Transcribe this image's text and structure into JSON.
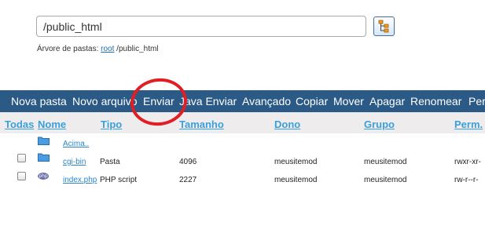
{
  "path_input": {
    "value": "/public_html"
  },
  "folder_tree": {
    "label": "Árvore de pastas:",
    "root_link": "root",
    "path": "/public_html"
  },
  "toolbar": {
    "items": [
      "Nova pasta",
      "Novo arquivo",
      "Enviar",
      "Java Enviar",
      "Avançado",
      "Copiar",
      "Mover",
      "Apagar",
      "Renomear",
      "Perm"
    ]
  },
  "columns": {
    "todas": "Todas",
    "nome": "Nome",
    "tipo": "Tipo",
    "tamanho": "Tamanho",
    "dono": "Dono",
    "grupo": "Grupo",
    "perm": "Perm."
  },
  "rows": [
    {
      "name": "Acima..",
      "type": "",
      "size": "",
      "owner": "",
      "group": "",
      "perm": "",
      "icon": "folder-icon"
    },
    {
      "name": "cgi-bin",
      "type": "Pasta",
      "size": "4096",
      "owner": "meusitemod",
      "group": "meusitemod",
      "perm": "rwxr-xr-",
      "icon": "folder-icon"
    },
    {
      "name": "index.php",
      "type": "PHP script",
      "size": "2227",
      "owner": "meusitemod",
      "group": "meusitemod",
      "perm": "rw-r--r-",
      "icon": "php-file-icon"
    }
  ],
  "annotation_color": "#e01e24",
  "toolbar_color": "#2b5a86"
}
